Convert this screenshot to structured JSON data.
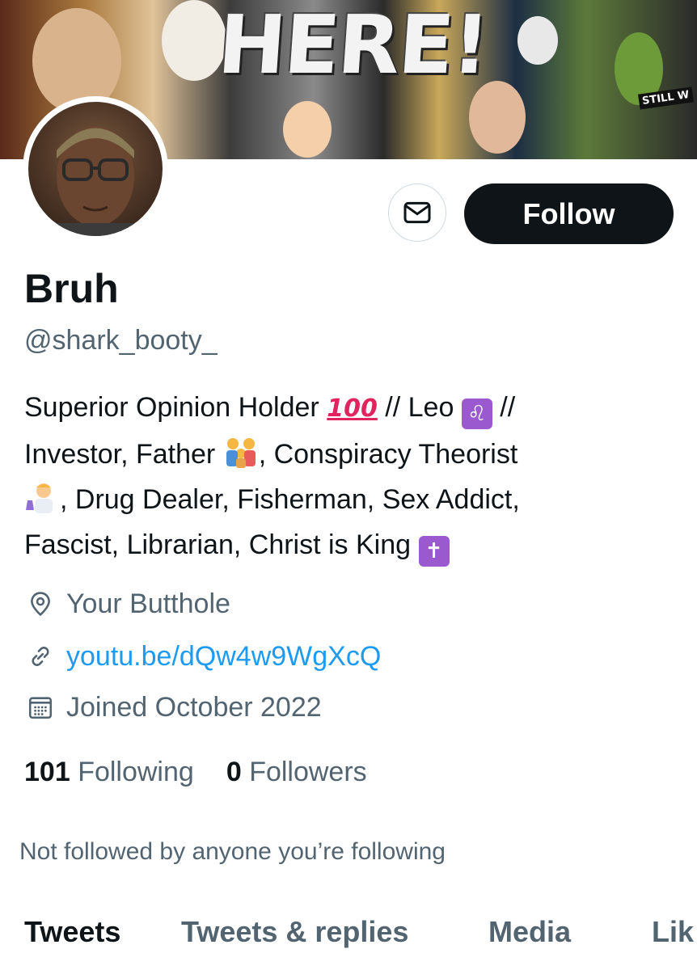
{
  "banner": {
    "headline": "HERE!",
    "corner_text": "STILL W"
  },
  "profile": {
    "name": "Bruh",
    "handle": "@shark_booty_",
    "bio": {
      "line1_a": "Superior Opinion Holder",
      "line1_hundred": "100",
      "line1_b": "// Leo",
      "leo_symbol": "♌",
      "line1_c": "//",
      "line2_a": "Investor, Father",
      "line2_b": ", Conspiracy Theorist",
      "line3": ", Drug Dealer, Fisherman, Sex Addict,",
      "line4": "Fascist, Librarian, Christ is King",
      "cross_symbol": "✝"
    },
    "location": "Your Butthole",
    "website": "youtu.be/dQw4w9WgXcQ",
    "joined": "Joined October 2022",
    "following_count": "101",
    "following_label": "Following",
    "followers_count": "0",
    "followers_label": "Followers",
    "not_followed_text": "Not followed by anyone you’re following"
  },
  "actions": {
    "follow_label": "Follow"
  },
  "tabs": [
    {
      "label": "Tweets",
      "active": true
    },
    {
      "label": "Tweets & replies",
      "active": false
    },
    {
      "label": "Media",
      "active": false
    },
    {
      "label": "Lik",
      "active": false
    }
  ],
  "colors": {
    "accent": "#1d9bf0",
    "primary_text": "#0f1419",
    "secondary_text": "#536471",
    "emoji_purple": "#9b59d0",
    "hundred_red": "#e0245e"
  }
}
